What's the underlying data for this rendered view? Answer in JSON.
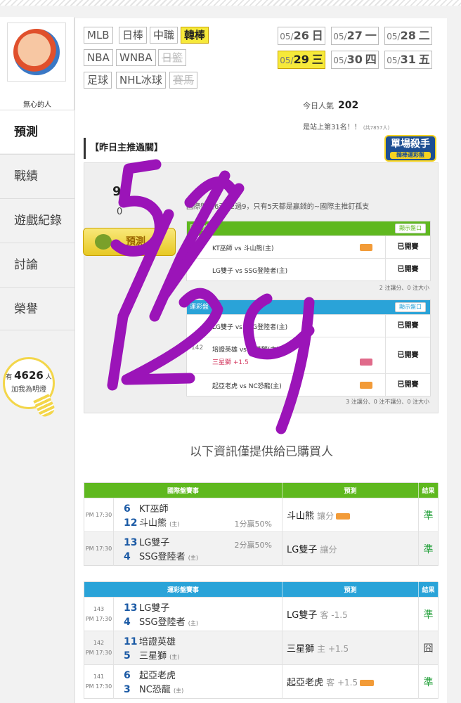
{
  "user": {
    "name": "無心的人"
  },
  "sidebar": {
    "items": [
      {
        "label": "預測"
      },
      {
        "label": "戰績"
      },
      {
        "label": "遊戲紀錄"
      },
      {
        "label": "討論"
      },
      {
        "label": "榮譽"
      }
    ]
  },
  "fans": {
    "prefix": "有",
    "count": "4626",
    "suffix": "人",
    "label": "加我為明燈"
  },
  "leagues": [
    "MLB",
    "日棒",
    "中職",
    "韓棒",
    "NBA",
    "WNBA",
    "日籃",
    "足球",
    "NHL冰球",
    "賽馬"
  ],
  "dates": [
    {
      "md": "05/",
      "d": "26",
      "w": "日"
    },
    {
      "md": "05/",
      "d": "27",
      "w": "一"
    },
    {
      "md": "05/",
      "d": "28",
      "w": "二"
    },
    {
      "md": "05/",
      "d": "29",
      "w": "三"
    },
    {
      "md": "05/",
      "d": "30",
      "w": "四"
    },
    {
      "md": "05/",
      "d": "31",
      "w": "五"
    }
  ],
  "stats": {
    "popularity_label": "今日人氣",
    "popularity": "202",
    "rank_text": "是站上第31名！！",
    "rank_total": "(共7857人)"
  },
  "yesterday": {
    "title": "【昨日主推過關】",
    "badge": "單場殺手",
    "badge_sub": "韓棒運彩盤",
    "big_number": "99",
    "big_number2": "0",
    "button": "預測",
    "description": "國際盤近6天12過9，只有5天都是贏錢的~國際主推釘孤支",
    "intl": {
      "header": "國際盤",
      "button": "顯示盤口",
      "rows": [
        {
          "text": "KT巫師 vs 斗山熊(主)",
          "result": "已開賽"
        },
        {
          "text": "LG雙子 vs SSG登陸者(主)",
          "result": "已開賽"
        }
      ],
      "note": "2 注讓分、0 注大小"
    },
    "sports": {
      "header": "運彩盤",
      "button": "顯示盤口",
      "rows": [
        {
          "text": "LG雙子 vs SSG登陸者(主)",
          "result": "已開賽"
        },
        {
          "no": "142",
          "text": "培證英雄 vs 三星獅(主)",
          "extra": "三星獅 +1.5",
          "result": "已開賽"
        },
        {
          "text": "起亞老虎 vs NC恐龍(主)",
          "result": "已開賽"
        }
      ],
      "note": "3 注讓分、0 注不讓分、0 注大小"
    }
  },
  "info_text": "以下資訊僅提供給已購買人",
  "intl_table": {
    "headers": [
      "國際盤賽事",
      "預測",
      "結果"
    ],
    "rows": [
      {
        "time": "PM 17:30",
        "away_no": "6",
        "away": "KT巫師",
        "home_no": "12",
        "home": "斗山熊",
        "home_tag": "(主)",
        "odds": "1分贏50%",
        "pick": "斗山熊",
        "pick_type": "讓分",
        "result": "準"
      },
      {
        "time": "PM 17:30",
        "away_no": "13",
        "away": "LG雙子",
        "home_no": "4",
        "home": "SSG登陸者",
        "home_tag": "(主)",
        "odds": "2分贏50%",
        "pick": "LG雙子",
        "pick_type": "讓分",
        "result": "準"
      }
    ]
  },
  "sports_table": {
    "headers": [
      "運彩盤賽事",
      "預測",
      "結果"
    ],
    "rows": [
      {
        "no": "143",
        "time": "PM 17:30",
        "away_no": "13",
        "away": "LG雙子",
        "home_no": "4",
        "home": "SSG登陸者",
        "home_tag": "(主)",
        "pick": "LG雙子",
        "pick_type": "客 -1.5",
        "result": "準"
      },
      {
        "no": "142",
        "time": "PM 17:30",
        "away_no": "11",
        "away": "培證英雄",
        "home_no": "5",
        "home": "三星獅",
        "home_tag": "(主)",
        "pick": "三星獅",
        "pick_type": "主 +1.5",
        "result": "囧"
      },
      {
        "no": "141",
        "time": "PM 17:30",
        "away_no": "6",
        "away": "起亞老虎",
        "home_no": "3",
        "home": "NC恐龍",
        "home_tag": "(主)",
        "pick": "起亞老虎",
        "pick_type": "客 +1.5",
        "result": "準"
      }
    ]
  },
  "handwriting": "5/29",
  "colors": {
    "accent_yellow": "#f6e93a",
    "green": "#5fb81f",
    "blue": "#2aa3d8",
    "ink": "#9b14b8",
    "win": "#23a03a"
  }
}
